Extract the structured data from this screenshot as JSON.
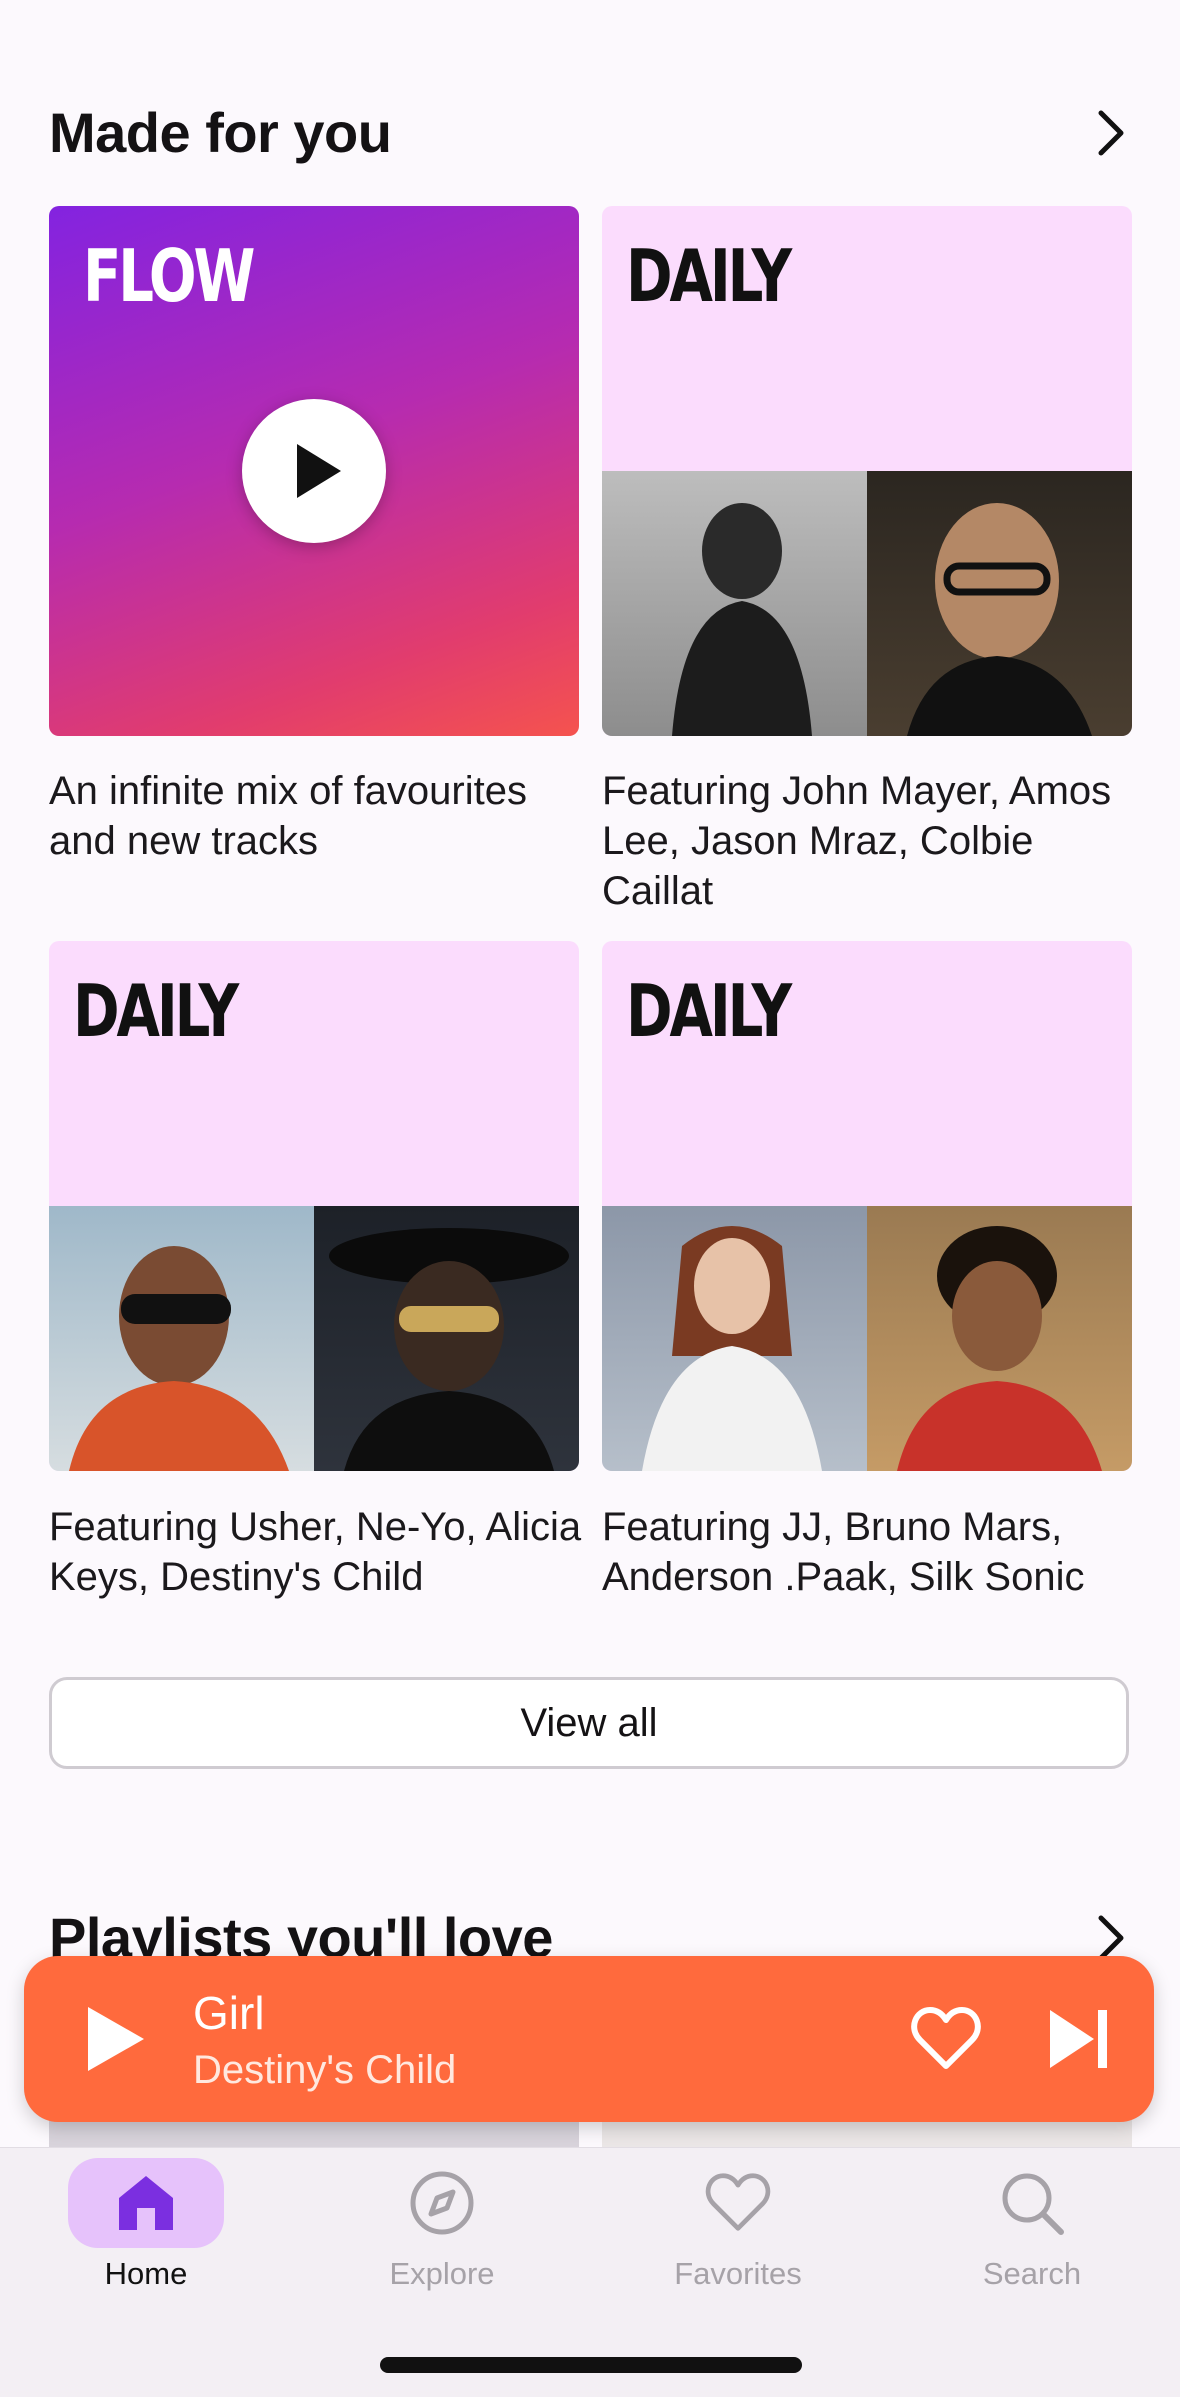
{
  "made_for_you": {
    "title": "Made for you",
    "cards": [
      {
        "brand": "FLOW",
        "caption": "An infinite mix of favourites and new tracks"
      },
      {
        "brand": "DAILY",
        "caption": "Featuring John Mayer, Amos Lee, Jason Mraz, Colbie Caillat"
      },
      {
        "brand": "DAILY",
        "caption": "Featuring Usher, Ne-Yo, Alicia Keys, Destiny's Child"
      },
      {
        "brand": "DAILY",
        "caption": "Featuring JJ, Bruno Mars, Anderson .Paak, Silk Sonic"
      }
    ],
    "view_all": "View all"
  },
  "playlists": {
    "title": "Playlists you'll love"
  },
  "mini_player": {
    "title": "Girl",
    "artist": "Destiny's Child"
  },
  "tabs": [
    {
      "label": "Home",
      "icon": "home-icon",
      "active": true
    },
    {
      "label": "Explore",
      "icon": "compass-icon",
      "active": false
    },
    {
      "label": "Favorites",
      "icon": "heart-icon",
      "active": false
    },
    {
      "label": "Search",
      "icon": "search-icon",
      "active": false
    }
  ],
  "colors": {
    "accent": "#7b2fe0",
    "mini_player": "#ff6a3d",
    "daily_bg": "#fbdcfd",
    "active_tab_bg": "#e6c2fb"
  }
}
